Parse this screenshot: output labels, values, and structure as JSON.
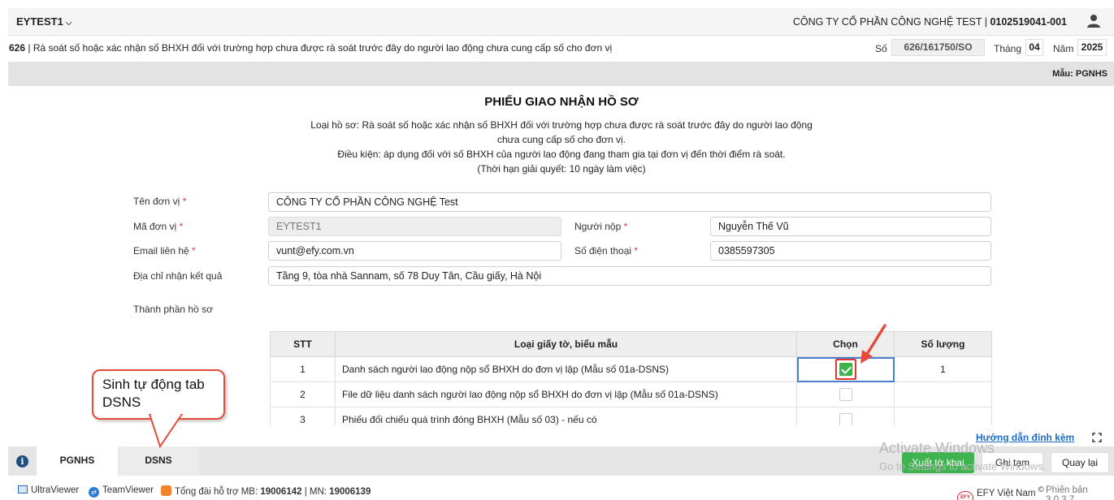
{
  "header": {
    "tenant": "EYTEST1",
    "company_name": "CÔNG TY CỔ PHẦN CÔNG NGHỆ TEST | ",
    "company_code": "0102519041-001"
  },
  "subheader": {
    "form_code": "626",
    "form_title": " | Rà soát số hoặc xác nhận số BHXH đối với trường hợp chưa được rà soát trước đây do người lao động chưa cung cấp số cho đơn vị",
    "so_label": "Số",
    "so_value": "626/161750/SO",
    "month_label": "Tháng",
    "month_value": "04",
    "year_label": "Năm",
    "year_value": "2025"
  },
  "template_label": "Mẫu: PGNHS",
  "document": {
    "title": "PHIẾU GIAO NHẬN HỒ SƠ",
    "desc_1": "Loại hồ sơ: Rà soát số hoặc xác nhận số BHXH đối với trường hợp chưa được rà soát trước đây do người lao động",
    "desc_2": "chưa cung cấp số cho đơn vị.",
    "desc_3": "Điều kiện: áp dụng đối với số BHXH của người lao động đang tham gia tại đơn vị đến thời điểm rà soát.",
    "desc_4": "(Thời hạn giải quyết: 10 ngày làm việc)"
  },
  "form": {
    "unit_name_label": "Tên đơn vị",
    "unit_name_value": "CÔNG TY CỔ PHẦN CÔNG NGHỆ Test",
    "unit_code_label": "Mã đơn vị",
    "unit_code_value": "EYTEST1",
    "submitter_label": "Người nộp",
    "submitter_value": "Nguyễn Thế Vũ",
    "email_label": "Email liên hệ",
    "email_value": "vunt@efy.com.vn",
    "phone_label": "Số điện thoại",
    "phone_value": "0385597305",
    "address_label": "Địa chỉ nhận kết quả",
    "address_value": "Tầng 9, tòa nhà Sannam, số 78 Duy Tân, Cầu giấy, Hà Nội",
    "components_label": "Thành phần hồ sơ",
    "required_mark": "*"
  },
  "table": {
    "headers": [
      "STT",
      "Loại giấy tờ, biểu mẫu",
      "Chọn",
      "Số lượng"
    ],
    "rows": [
      {
        "stt": "1",
        "name": "Danh sách người lao động nộp sổ BHXH do đơn vị lập (Mẫu số 01a-DSNS)",
        "checked": true,
        "qty": "1"
      },
      {
        "stt": "2",
        "name": "File dữ liệu danh sách người lao động nộp sổ BHXH do đơn vị lập (Mẫu số 01a-DSNS)",
        "checked": false,
        "qty": ""
      },
      {
        "stt": "3",
        "name": "Phiếu đối chiếu quá trình đóng BHXH (Mẫu số 03) - nếu có",
        "checked": false,
        "qty": ""
      }
    ]
  },
  "callout": {
    "line1": "Sinh tự động tab",
    "line2": "DSNS"
  },
  "guide_link": "Hướng dẫn đính kèm",
  "tabs": [
    "PGNHS",
    "DSNS"
  ],
  "buttons": {
    "export": "Xuất tờ khai",
    "save_draft": "Ghi tạm",
    "back": "Quay lại"
  },
  "watermark": {
    "line1": "Activate Windows",
    "line2": "Go to Settings to activate Windows."
  },
  "footer": {
    "ultraviewer": "UltraViewer",
    "teamviewer": "TeamViewer",
    "hotline_prefix": "Tổng đài hỗ trợ MB: ",
    "hotline_mb": "19006142",
    "hotline_sep": " | MN: ",
    "hotline_mn": "19006139",
    "brand": "EFY Việt Nam",
    "registered": "©",
    "version": "Phiên bản 3.0.3.7"
  },
  "colors": {
    "accent_green": "#3fb34f",
    "link_blue": "#1e6ec8",
    "required_red": "#e0382e",
    "annotation_red": "#e64a3b"
  }
}
